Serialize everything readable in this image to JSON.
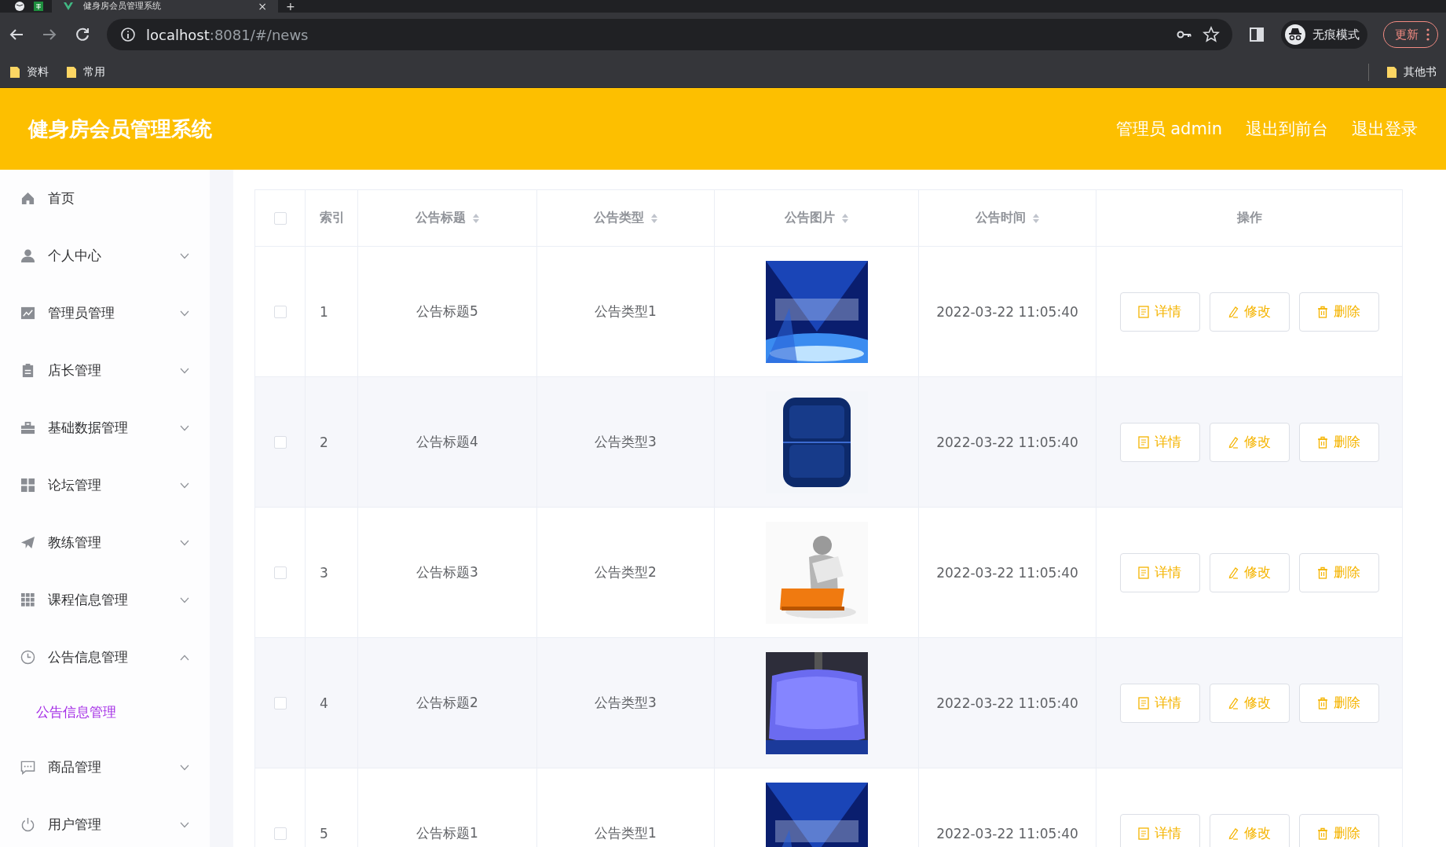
{
  "browser": {
    "tab_title": "健身房会员管理系统",
    "tab_close": "×",
    "new_tab": "+",
    "url_host": "localhost",
    "url_rest": ":8081/#/news",
    "incognito": "无痕模式",
    "update": "更新",
    "bookmarks": [
      "资料",
      "常用"
    ],
    "other_bookmarks": "其他书"
  },
  "header": {
    "title": "健身房会员管理系统",
    "links": [
      "管理员 admin",
      "退出到前台",
      "退出登录"
    ]
  },
  "sidebar": {
    "items": [
      {
        "label": "首页",
        "kind": "link"
      },
      {
        "label": "个人中心",
        "kind": "submenu",
        "expanded": false
      },
      {
        "label": "管理员管理",
        "kind": "submenu",
        "expanded": false
      },
      {
        "label": "店长管理",
        "kind": "submenu",
        "expanded": false
      },
      {
        "label": "基础数据管理",
        "kind": "submenu",
        "expanded": false
      },
      {
        "label": "论坛管理",
        "kind": "submenu",
        "expanded": false
      },
      {
        "label": "教练管理",
        "kind": "submenu",
        "expanded": false
      },
      {
        "label": "课程信息管理",
        "kind": "submenu",
        "expanded": false
      },
      {
        "label": "公告信息管理",
        "kind": "submenu",
        "expanded": true,
        "children": [
          {
            "label": "公告信息管理",
            "selected": true
          }
        ]
      },
      {
        "label": "商品管理",
        "kind": "submenu",
        "expanded": false
      },
      {
        "label": "用户管理",
        "kind": "submenu",
        "expanded": false
      }
    ]
  },
  "table": {
    "select_all_checked": false,
    "columns": [
      {
        "label": "索引",
        "sortable": false
      },
      {
        "label": "公告标题",
        "sortable": true
      },
      {
        "label": "公告类型",
        "sortable": true
      },
      {
        "label": "公告图片",
        "sortable": true
      },
      {
        "label": "公告时间",
        "sortable": true
      },
      {
        "label": "操作",
        "sortable": false
      }
    ],
    "rows": [
      {
        "checked": false,
        "index": "1",
        "title": "公告标题5",
        "type": "公告类型1",
        "time": "2022-03-22 11:05:40",
        "actions": [
          "详情",
          "修改",
          "删除"
        ]
      },
      {
        "checked": false,
        "index": "2",
        "title": "公告标题4",
        "type": "公告类型3",
        "time": "2022-03-22 11:05:40",
        "actions": [
          "详情",
          "修改",
          "删除"
        ]
      },
      {
        "checked": false,
        "index": "3",
        "title": "公告标题3",
        "type": "公告类型2",
        "time": "2022-03-22 11:05:40",
        "actions": [
          "详情",
          "修改",
          "删除"
        ]
      },
      {
        "checked": false,
        "index": "4",
        "title": "公告标题2",
        "type": "公告类型3",
        "time": "2022-03-22 11:05:40",
        "actions": [
          "详情",
          "修改",
          "删除"
        ]
      },
      {
        "checked": false,
        "index": "5",
        "title": "公告标题1",
        "type": "公告类型1",
        "time": "2022-03-22 11:05:40",
        "actions": [
          "详情",
          "修改",
          "删除"
        ]
      }
    ]
  }
}
